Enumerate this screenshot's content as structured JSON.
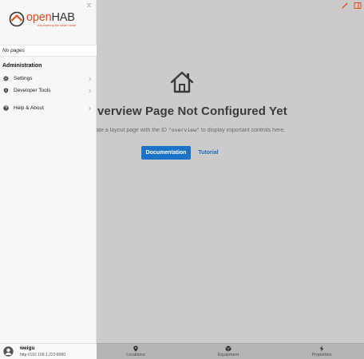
{
  "sidebar": {
    "brand": {
      "name_part1": "open",
      "name_part2": "HAB",
      "tagline": "empowering the smart home"
    },
    "no_pages": "No pages",
    "section_title": "Administration",
    "items": [
      {
        "label": "Settings",
        "icon": "gear-icon"
      },
      {
        "label": "Developer Tools",
        "icon": "wrench-icon"
      },
      {
        "label": "Help & About",
        "icon": "question-icon"
      }
    ],
    "user": {
      "name": "weigu",
      "url": "http://192.168.1.223:8080"
    }
  },
  "main": {
    "title": "Overview Page Not Configured Yet",
    "description_pre": "Create a layout page with the ID ",
    "description_code": "\"overview\"",
    "description_post": " to display important controls here.",
    "doc_button": "Documentation",
    "tutorial_button": "Tutorial"
  },
  "tabs": [
    {
      "label": "Locations",
      "icon": "map-pin-icon"
    },
    {
      "label": "Equipment",
      "icon": "cube-icon"
    },
    {
      "label": "Properties",
      "icon": "bolt-icon"
    }
  ],
  "colors": {
    "accent": "#e64a19",
    "primary": "#1a73c6"
  }
}
